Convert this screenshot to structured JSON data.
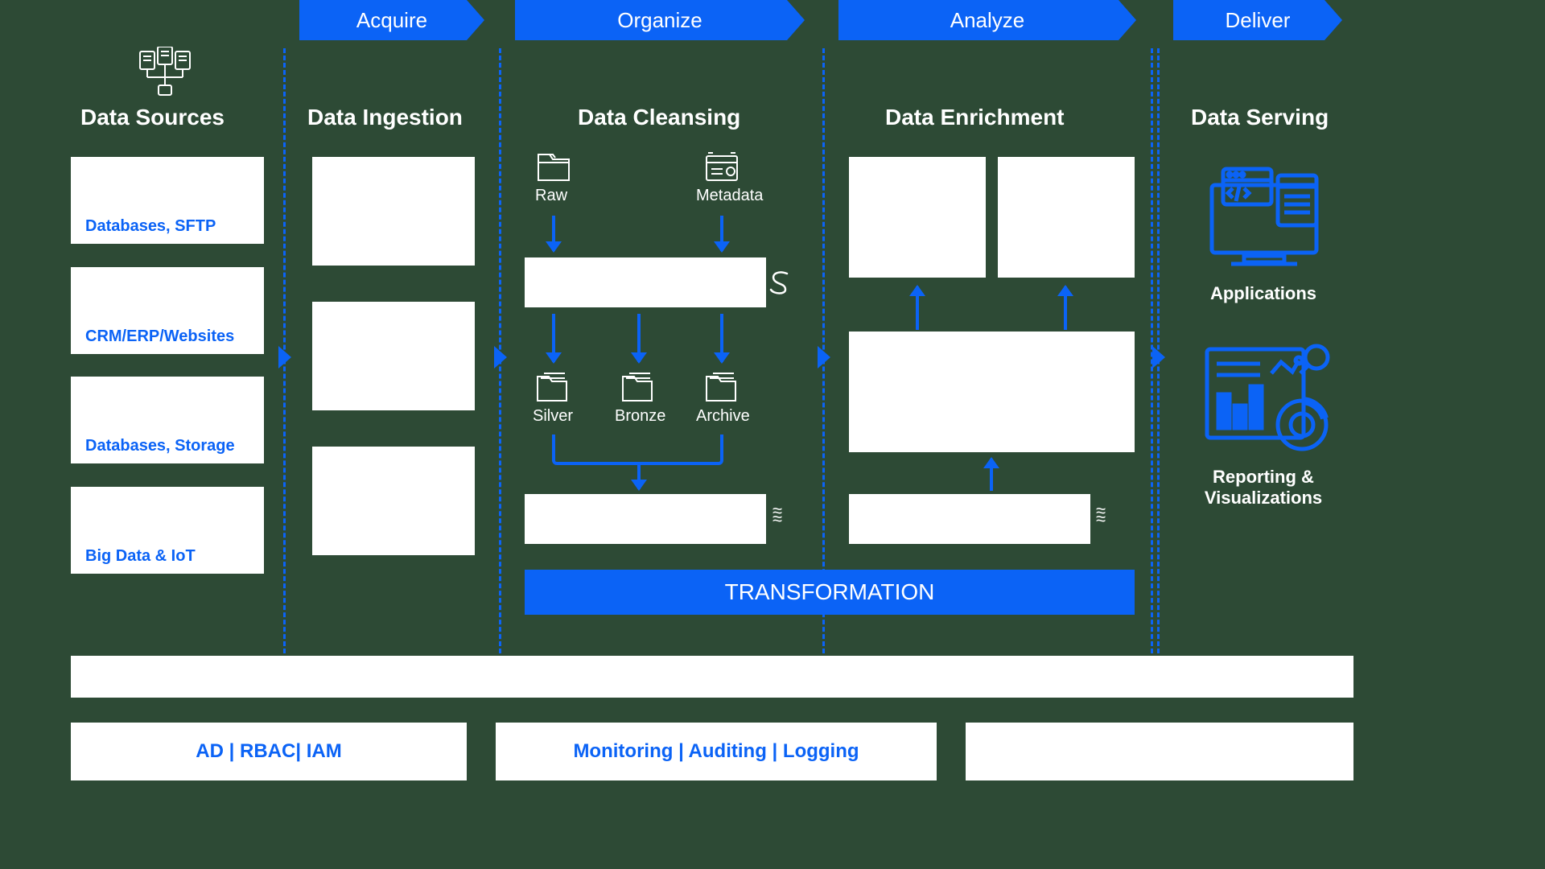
{
  "stages": {
    "acquire": "Acquire",
    "organize": "Organize",
    "analyze": "Analyze",
    "deliver": "Deliver"
  },
  "sections": {
    "sources": "Data Sources",
    "ingestion": "Data Ingestion",
    "cleansing": "Data Cleansing",
    "enrichment": "Data Enrichment",
    "serving": "Data Serving"
  },
  "sources": {
    "s1": "Databases, SFTP",
    "s2": "CRM/ERP/Websites",
    "s3": "Databases, Storage",
    "s4": "Big Data & IoT"
  },
  "cleansing": {
    "raw": "Raw",
    "metadata": "Metadata",
    "silver": "Silver",
    "bronze": "Bronze",
    "archive": "Archive"
  },
  "transformation": "TRANSFORMATION",
  "serving": {
    "applications": "Applications",
    "reporting": "Reporting & Visualizations"
  },
  "footer": {
    "f1": "AD | RBAC| IAM",
    "f2": "Monitoring | Auditing | Logging"
  }
}
